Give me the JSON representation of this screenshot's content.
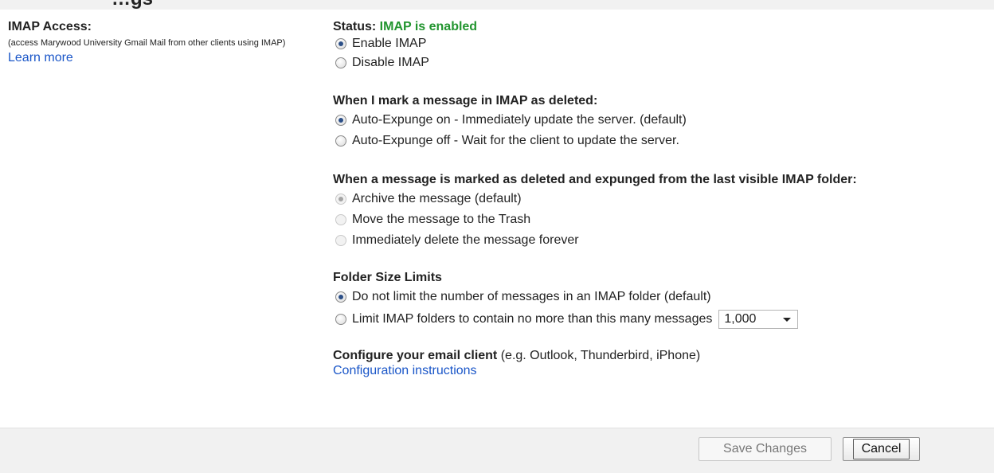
{
  "header": {
    "partial_title": "…gs"
  },
  "imap_access": {
    "label": "IMAP Access:",
    "description": "(access Marywood University Gmail Mail from other clients using IMAP)",
    "learn_more": "Learn more"
  },
  "status": {
    "prefix": "Status: ",
    "value": "IMAP is enabled",
    "value_color": "#22952f"
  },
  "enable_options": [
    {
      "label": "Enable IMAP",
      "checked": true
    },
    {
      "label": "Disable IMAP",
      "checked": false
    }
  ],
  "deleted_group": {
    "title": "When I mark a message in IMAP as deleted:",
    "options": [
      {
        "label": "Auto-Expunge on - Immediately update the server. (default)",
        "checked": true
      },
      {
        "label": "Auto-Expunge off - Wait for the client to update the server.",
        "checked": false
      }
    ]
  },
  "expunged_group": {
    "title": "When a message is marked as deleted and expunged from the last visible IMAP folder:",
    "options": [
      {
        "label": "Archive the message (default)",
        "checked": true
      },
      {
        "label": "Move the message to the Trash",
        "checked": false
      },
      {
        "label": "Immediately delete the message forever",
        "checked": false
      }
    ]
  },
  "folder_limits": {
    "title": "Folder Size Limits",
    "options": [
      {
        "label": "Do not limit the number of messages in an IMAP folder (default)",
        "checked": true
      },
      {
        "label": "Limit IMAP folders to contain no more than this many messages",
        "checked": false
      }
    ],
    "limit_value": "1,000"
  },
  "configure": {
    "title": "Configure your email client",
    "hint": " (e.g. Outlook, Thunderbird, iPhone)",
    "link": "Configuration instructions"
  },
  "footer": {
    "save_label": "Save Changes",
    "cancel_label": "Cancel"
  },
  "icons": {
    "radio": "radio-button-icon",
    "caret": "dropdown-caret-icon"
  },
  "colors": {
    "link": "#1a56c8",
    "footer_bg": "#f1f1f1"
  }
}
